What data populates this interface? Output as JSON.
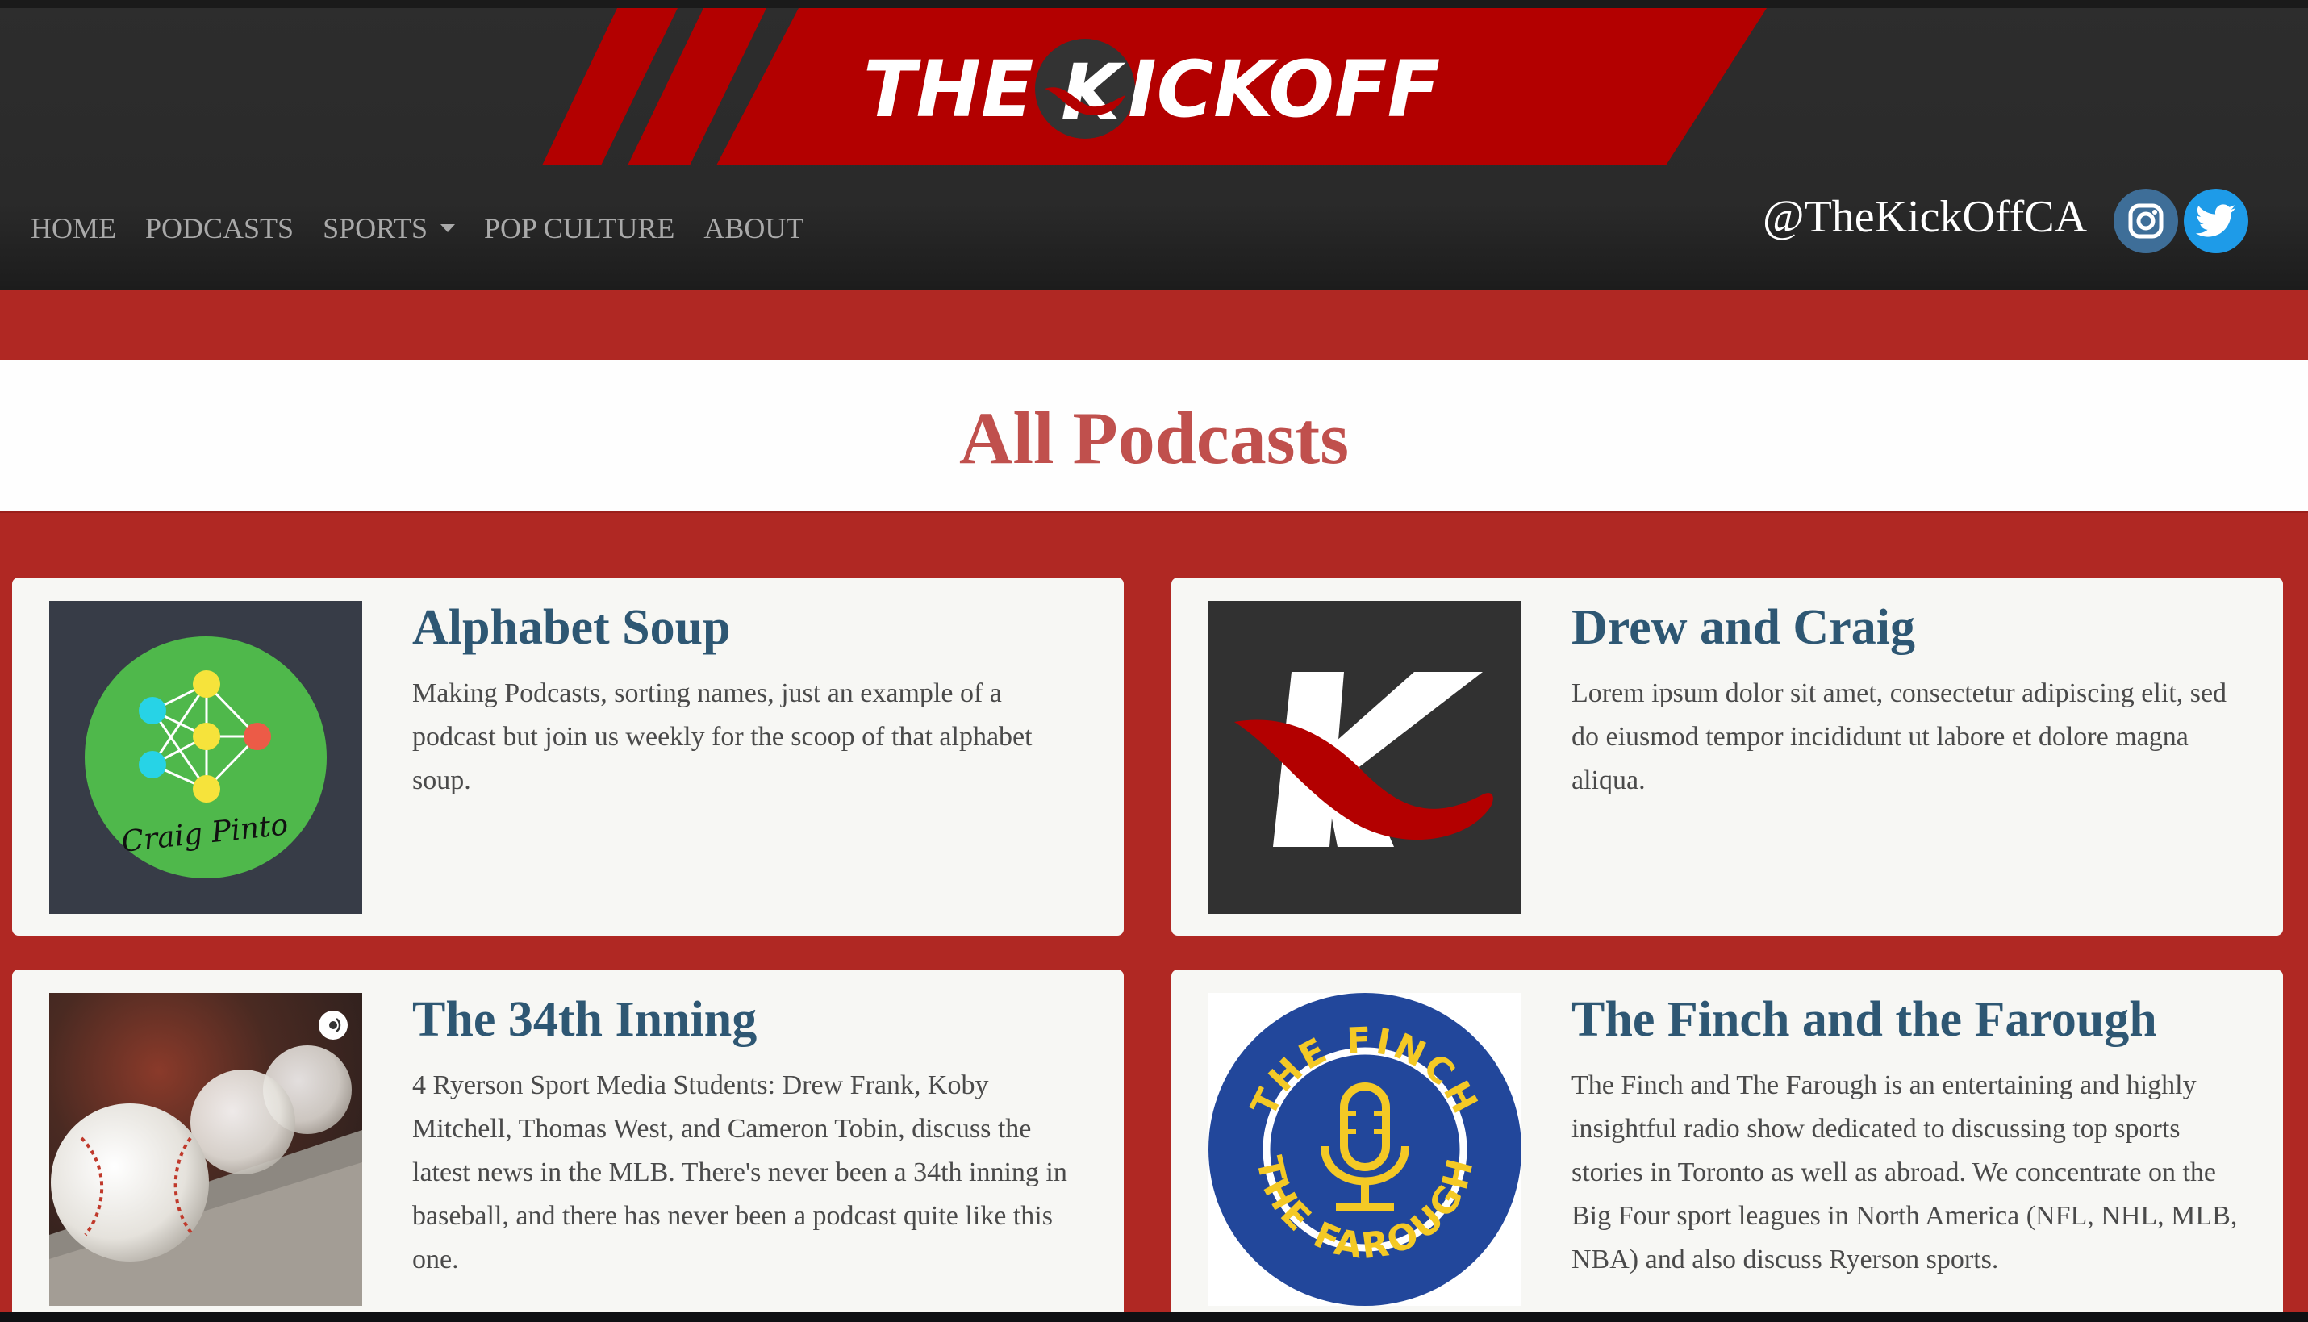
{
  "header": {
    "logo": {
      "word1": "THE",
      "word2": "ICKOFF",
      "badge_letter": "K"
    },
    "nav": [
      {
        "label": "HOME"
      },
      {
        "label": "PODCASTS"
      },
      {
        "label": "SPORTS"
      },
      {
        "label": "POP CULTURE"
      },
      {
        "label": "ABOUT"
      }
    ],
    "handle": "@TheKickOffCA",
    "social_icons": [
      "instagram-icon",
      "twitter-icon"
    ]
  },
  "page": {
    "title": "All Podcasts"
  },
  "podcasts": [
    {
      "title": "Alphabet Soup",
      "description": "Making Podcasts, sorting names, just an example of a podcast but join us weekly for the scoop of that alphabet soup.",
      "thumb_caption": "Craig Pinto"
    },
    {
      "title": "Drew and Craig",
      "description": "Lorem ipsum dolor sit amet, consectetur adipiscing elit, sed do eiusmod tempor incididunt ut labore et dolore magna aliqua."
    },
    {
      "title": "The 34th Inning",
      "description": "4 Ryerson Sport Media Students: Drew Frank, Koby Mitchell, Thomas West, and Cameron Tobin, discuss the latest news in the MLB. There's never been a 34th inning in baseball, and there has never been a podcast quite like this one."
    },
    {
      "title": "The Finch and the Farough",
      "description": "The Finch and The Farough is an entertaining and highly insightful radio show dedicated to discussing top sports stories in Toronto as well as abroad. We concentrate on the Big Four sport leagues in North America (NFL, NHL, MLB, NBA) and also discuss Ryerson sports.",
      "thumb_top_text": "THE FINCH",
      "thumb_bottom_text": "THE FAROUGH"
    }
  ],
  "colors": {
    "brand_red": "#b02823",
    "logo_red": "#b30000",
    "header_bg": "#2a2a2a",
    "title_red": "#c0504d",
    "card_title_blue": "#2e5773"
  }
}
